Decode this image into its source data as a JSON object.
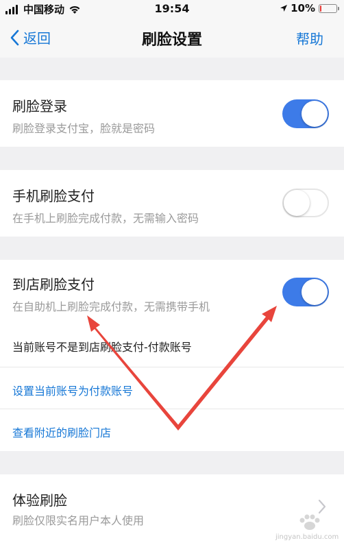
{
  "status_bar": {
    "carrier": "中国移动",
    "time": "19:54",
    "battery": "10%",
    "battery_level": 0.1,
    "icons": [
      "signal-icon",
      "wifi-icon",
      "location-icon",
      "battery-icon"
    ]
  },
  "nav": {
    "back_label": "返回",
    "title": "刷脸设置",
    "help_label": "帮助"
  },
  "sections": {
    "face_login": {
      "title": "刷脸登录",
      "desc": "刷脸登录支付宝，脸就是密码",
      "enabled": true
    },
    "phone_pay": {
      "title": "手机刷脸支付",
      "desc": "在手机上刷脸完成付款，无需输入密码",
      "enabled": false
    },
    "store_pay": {
      "title": "到店刷脸支付",
      "desc": "在自助机上刷脸完成付款，无需携带手机",
      "enabled": true,
      "account_note": "当前账号不是到店刷脸支付-付款账号",
      "set_account_link": "设置当前账号为付款账号",
      "nearby_stores_link": "查看附近的刷脸门店"
    },
    "try_face": {
      "title": "体验刷脸",
      "desc": "刷脸仅限实名用户本人使用"
    }
  },
  "colors": {
    "accent": "#1677d6",
    "toggle_on": "#3d7be8",
    "annotation_arrow": "#e8453c"
  },
  "watermark": {
    "text": "jingyan.baidu.com"
  }
}
